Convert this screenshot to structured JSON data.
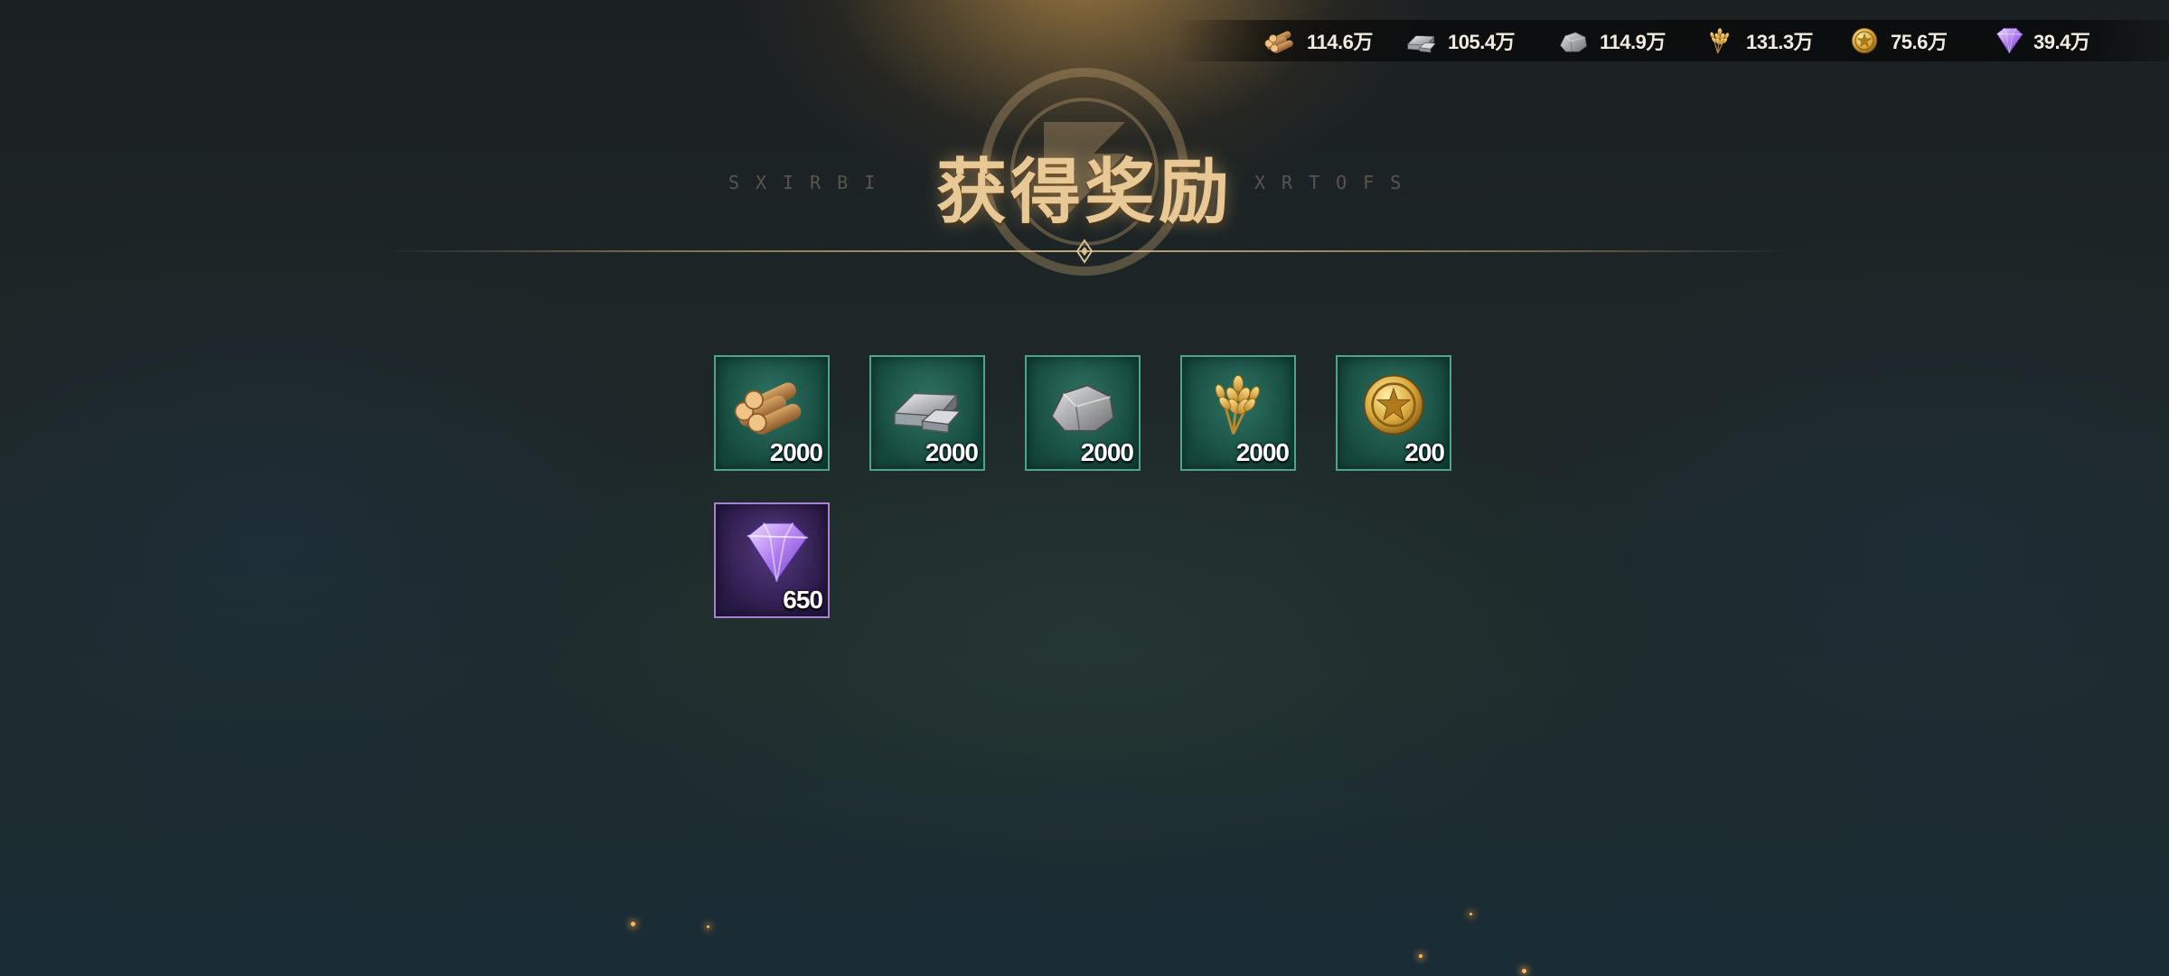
{
  "resources": [
    {
      "icon": "wood-icon",
      "value": "114.6万"
    },
    {
      "icon": "iron-ingot-icon",
      "value": "105.4万"
    },
    {
      "icon": "stone-icon",
      "value": "114.9万"
    },
    {
      "icon": "wheat-icon",
      "value": "131.3万"
    },
    {
      "icon": "gold-coin-icon",
      "value": "75.6万"
    },
    {
      "icon": "purple-gem-icon",
      "value": "39.4万"
    }
  ],
  "title": "获得奖励",
  "title_deco_left": "SXIRBI",
  "title_deco_right": "XRTOFS",
  "rewards": [
    {
      "icon": "wood-icon",
      "count": "2000",
      "rarity_color": "#4fa38a"
    },
    {
      "icon": "iron-ingot-icon",
      "count": "2000",
      "rarity_color": "#4fa38a"
    },
    {
      "icon": "stone-icon",
      "count": "2000",
      "rarity_color": "#4fa38a"
    },
    {
      "icon": "wheat-icon",
      "count": "2000",
      "rarity_color": "#4fa38a"
    },
    {
      "icon": "gold-coin-icon",
      "count": "200",
      "rarity_color": "#4fa38a"
    },
    {
      "icon": "purple-gem-icon",
      "count": "650",
      "rarity_color": "#a782d4"
    }
  ],
  "colors": {
    "title_gold": "#e8c894",
    "card_green": "#4fa38a",
    "card_purple": "#a782d4",
    "background": "#1d2b2c"
  }
}
